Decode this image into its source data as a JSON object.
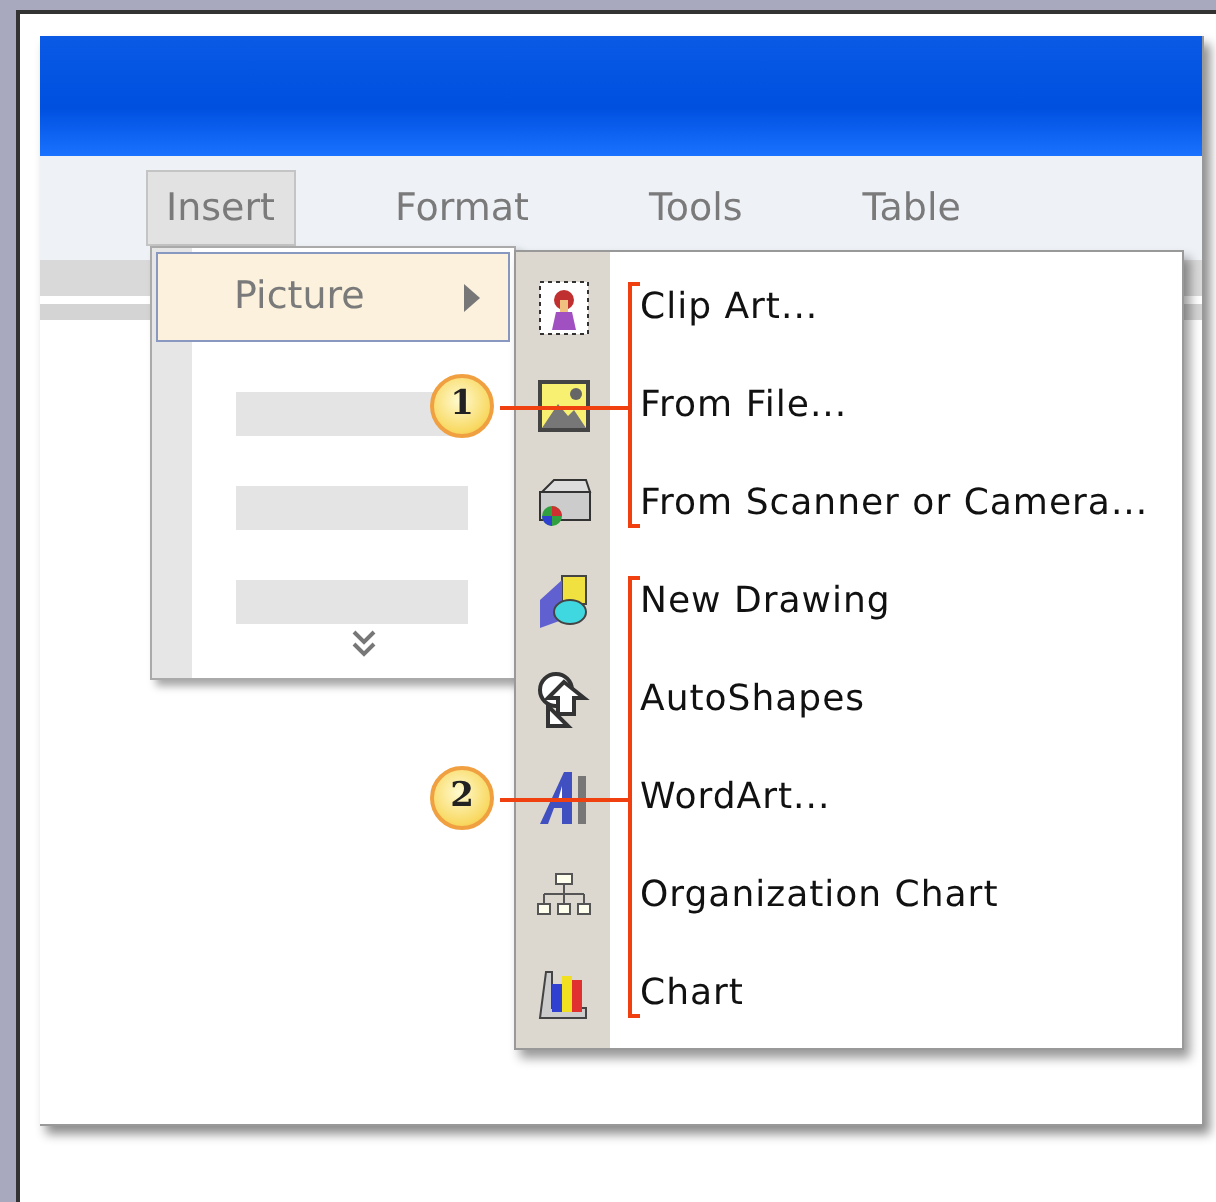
{
  "menu_bar": [
    {
      "label": "Insert",
      "selected": true
    },
    {
      "label": "Format",
      "selected": false
    },
    {
      "label": "Tools",
      "selected": false
    },
    {
      "label": "Table",
      "selected": false
    }
  ],
  "insert_menu": {
    "items": [
      {
        "kind": "submenu",
        "label": "Picture",
        "selected": true
      },
      {
        "kind": "placeholder"
      },
      {
        "kind": "placeholder"
      },
      {
        "kind": "placeholder"
      }
    ]
  },
  "picture_submenu": {
    "groups": [
      {
        "callout": "1",
        "items": [
          "Clip Art...",
          "From File...",
          "From Scanner or Camera..."
        ]
      },
      {
        "callout": "2",
        "items": [
          "New Drawing",
          "AutoShapes",
          "WordArt...",
          "Organization Chart",
          "Chart"
        ]
      }
    ]
  }
}
